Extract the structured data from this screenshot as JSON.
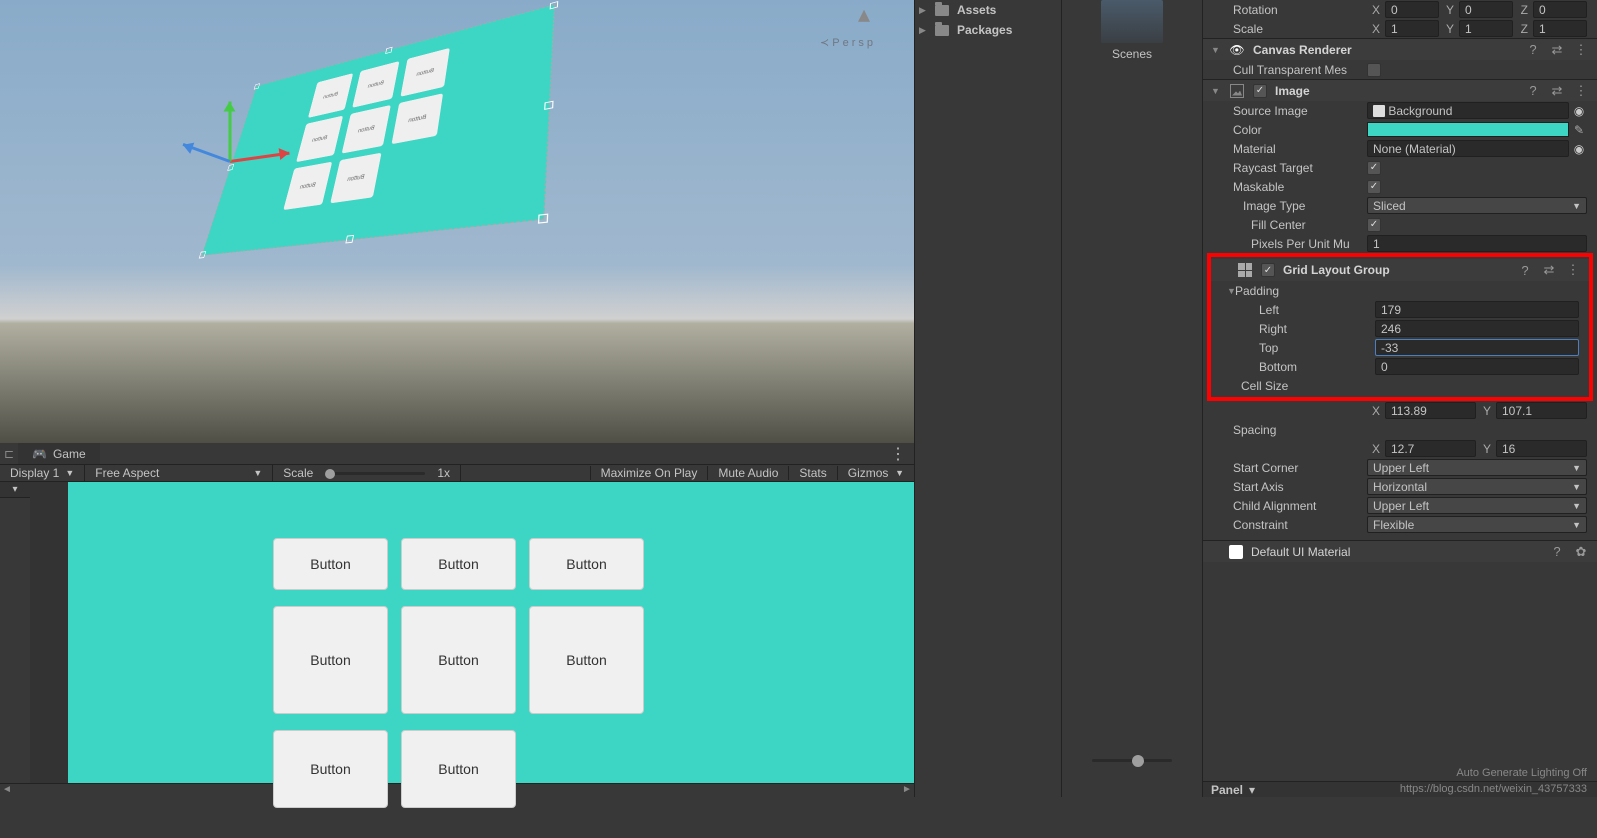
{
  "scene": {
    "persp": "Persp"
  },
  "game": {
    "tab": "Game",
    "display": "Display 1",
    "aspect": "Free Aspect",
    "scale_label": "Scale",
    "scale_value": "1x",
    "maximize": "Maximize On Play",
    "mute": "Mute Audio",
    "stats": "Stats",
    "gizmos": "Gizmos",
    "button_label": "Button"
  },
  "hierarchy": {
    "assets": "Assets",
    "packages": "Packages"
  },
  "thumb": {
    "label": "Scenes"
  },
  "transform": {
    "rotation": "Rotation",
    "rx": "0",
    "ry": "0",
    "rz": "0",
    "scale": "Scale",
    "sx": "1",
    "sy": "1",
    "sz": "1"
  },
  "canvas_renderer": {
    "title": "Canvas Renderer",
    "cull": "Cull Transparent Mes"
  },
  "image": {
    "title": "Image",
    "source_image": "Source Image",
    "source_value": "Background",
    "color": "Color",
    "material": "Material",
    "material_value": "None (Material)",
    "raycast": "Raycast Target",
    "maskable": "Maskable",
    "image_type": "Image Type",
    "image_type_value": "Sliced",
    "fill_center": "Fill Center",
    "ppu": "Pixels Per Unit Mu",
    "ppu_value": "1"
  },
  "grid_layout": {
    "title": "Grid Layout Group",
    "padding": "Padding",
    "left": "Left",
    "left_v": "179",
    "right": "Right",
    "right_v": "246",
    "top": "Top",
    "top_v": "-33",
    "bottom": "Bottom",
    "bottom_v": "0",
    "cell_size": "Cell Size",
    "cell_x": "113.89",
    "cell_y": "107.1",
    "spacing": "Spacing",
    "sp_x": "12.7",
    "sp_y": "16",
    "start_corner": "Start Corner",
    "start_corner_v": "Upper Left",
    "start_axis": "Start Axis",
    "start_axis_v": "Horizontal",
    "child_align": "Child Alignment",
    "child_align_v": "Upper Left",
    "constraint": "Constraint",
    "constraint_v": "Flexible"
  },
  "material": {
    "title": "Default UI Material"
  },
  "bottom": {
    "panel": "Panel",
    "auto_gen": "Auto Generate Lighting Off"
  },
  "watermark": "https://blog.csdn.net/weixin_43757333"
}
